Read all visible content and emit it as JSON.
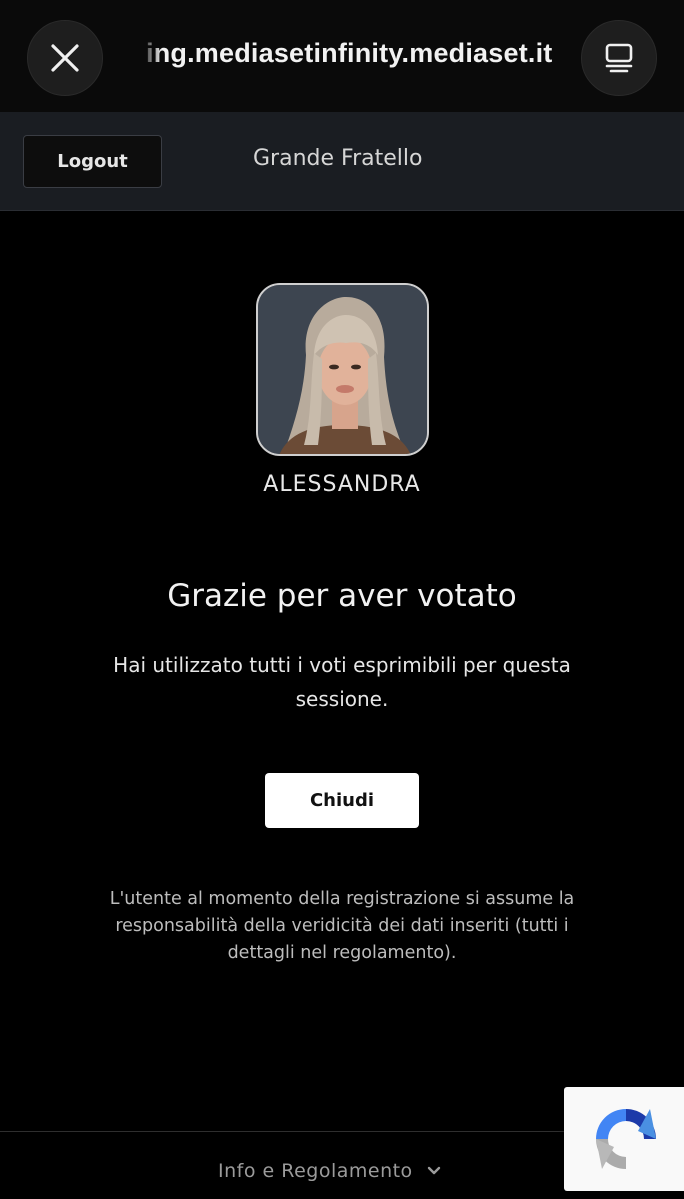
{
  "browser": {
    "url": "ing.mediasetinfinity.mediaset.it",
    "close_icon": "close-icon",
    "tabs_icon": "tabs-icon"
  },
  "header": {
    "logout_label": "Logout",
    "show_title": "Grande Fratello"
  },
  "contestant": {
    "name": "ALESSANDRA"
  },
  "confirmation": {
    "title": "Grazie per aver votato",
    "message": "Hai utilizzato tutti i voti esprimibili per questa sessione.",
    "close_label": "Chiudi"
  },
  "disclaimer": "L'utente al momento della registrazione si assume la responsabilità della veridicità dei dati inseriti (tutti i dettagli nel regolamento).",
  "footer": {
    "link_label": "Info e Regolamento",
    "link_icon": "chevron-down-icon"
  },
  "recaptcha_icon": "recaptcha-icon"
}
